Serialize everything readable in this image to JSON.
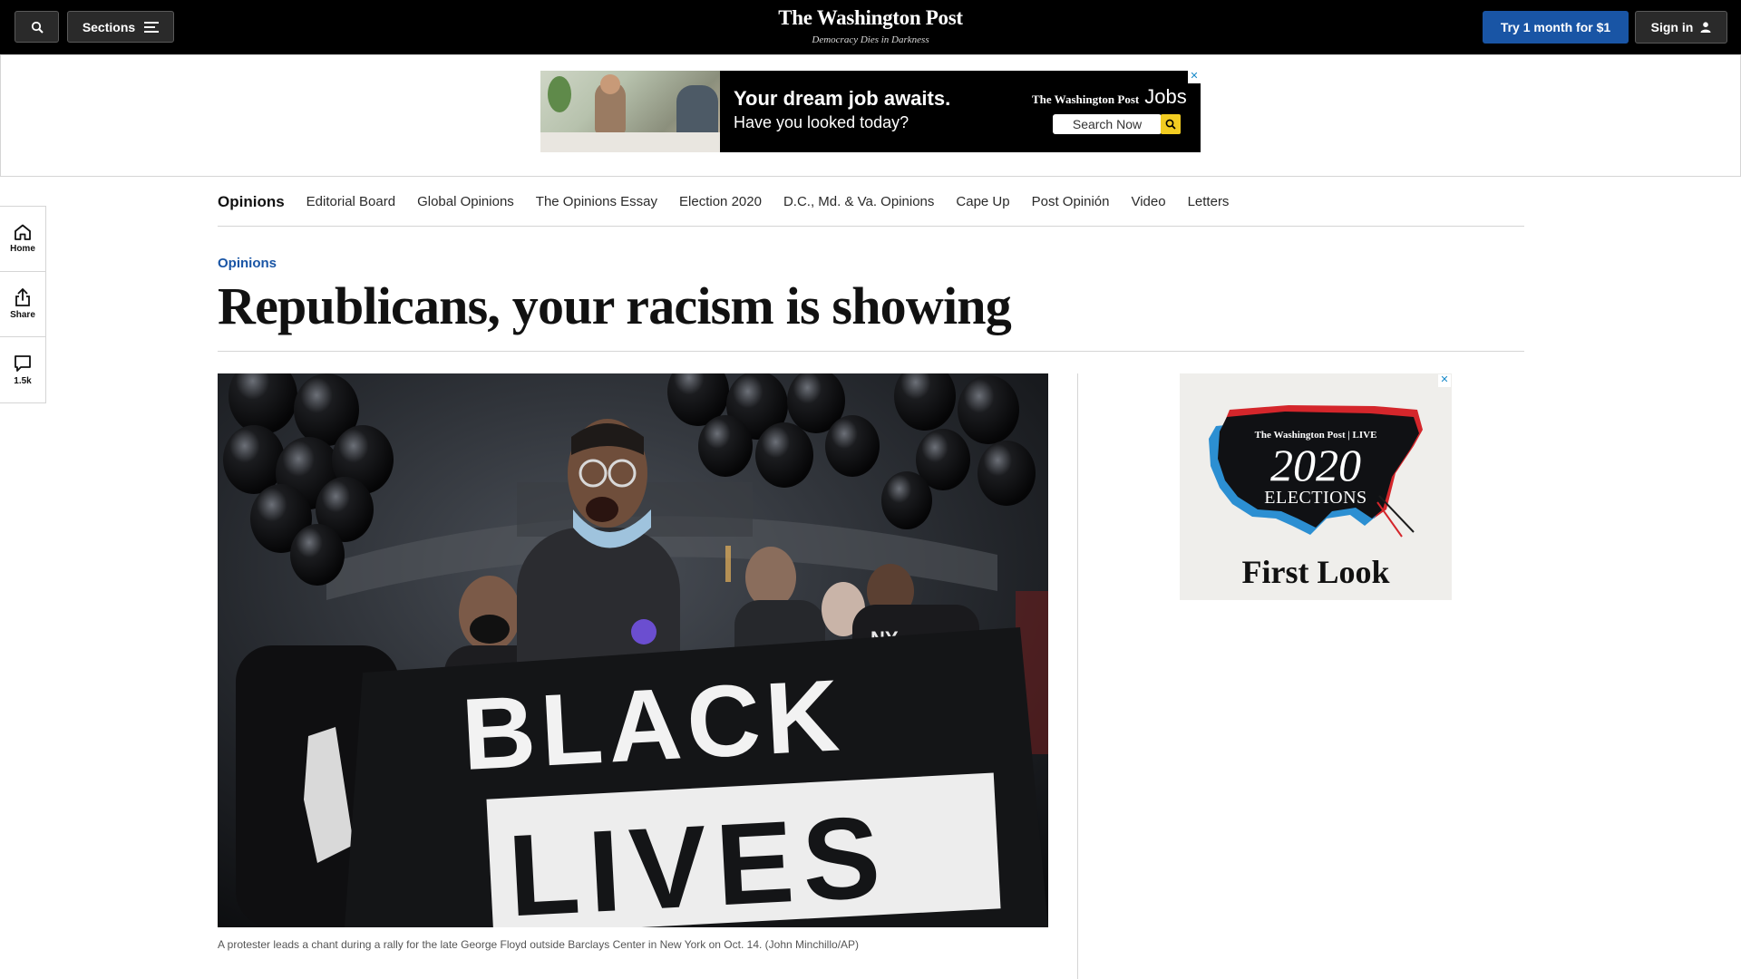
{
  "topbar": {
    "sections_label": "Sections",
    "brand_name": "The Washington Post",
    "brand_tagline": "Democracy Dies in Darkness",
    "try_label": "Try 1 month for $1",
    "signin_label": "Sign in"
  },
  "top_ad": {
    "headline": "Your dream job awaits.",
    "subline": "Have you looked today?",
    "brand": "The Washington Post",
    "brand_suffix": "Jobs",
    "search_label": "Search Now",
    "close": "✕"
  },
  "rail": {
    "home_label": "Home",
    "share_label": "Share",
    "comments_count": "1.5k"
  },
  "subnav": {
    "title": "Opinions",
    "items": [
      "Editorial Board",
      "Global Opinions",
      "The Opinions Essay",
      "Election 2020",
      "D.C., Md. & Va. Opinions",
      "Cape Up",
      "Post Opinión",
      "Video",
      "Letters"
    ]
  },
  "article": {
    "kicker": "Opinions",
    "headline": "Republicans, your racism is showing",
    "image_caption": "A protester leads a chant during a rally for the late George Floyd outside Barclays Center in New York on Oct. 14. (John Minchillo/AP)",
    "banner_line1": "BLACK",
    "banner_line2": "LIVES",
    "shirt_text": "NY"
  },
  "side_ad": {
    "brand": "The Washington Post | LIVE",
    "year": "2020",
    "word": "ELECTIONS",
    "tagline": "First Look",
    "close": "✕"
  },
  "colors": {
    "accent_blue": "#1955a5",
    "topbar_bg": "#000000",
    "ad_yellow": "#f2cc21",
    "divider": "#d5d5d5"
  }
}
